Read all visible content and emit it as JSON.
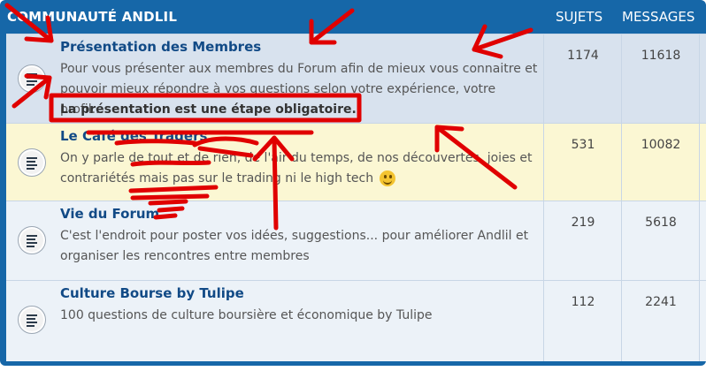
{
  "header": {
    "title": "COMMUNAUTÉ ANDLIL",
    "col_topics": "SUJETS",
    "col_posts": "MESSAGES"
  },
  "forums": [
    {
      "title": "Présentation des Membres",
      "description": "Pour vous présenter aux membres du Forum afin de mieux vous connaitre et pouvoir mieux répondre à vos questions selon votre expérience, votre profil...",
      "note": "La présentation est une étape obligatoire.",
      "topics": "1174",
      "posts": "11618",
      "icon": "forum-read-icon"
    },
    {
      "title": "Le Café des Traders",
      "description": "On y parle de tout et de rien, de l'air du temps, de nos découvertes, joies et contrariétés mais pas sur le trading ni le high tech",
      "topics": "531",
      "posts": "10082",
      "icon": "forum-read-icon",
      "emoji": "wink-smiley-icon"
    },
    {
      "title": "Vie du Forum",
      "description": "C'est l'endroit pour poster vos idées, suggestions... pour améliorer Andlil et organiser les rencontres entre membres",
      "topics": "219",
      "posts": "5618",
      "icon": "forum-read-icon"
    },
    {
      "title": "Culture Bourse by Tulipe",
      "description": "100 questions de culture boursière et économique by Tulipe",
      "topics": "112",
      "posts": "2241",
      "icon": "forum-read-icon"
    }
  ],
  "colors": {
    "header_bg": "#1667a8",
    "row_default": "#ecf2f8",
    "row_hover": "#d8e2ee",
    "row_highlight": "#fbf7d3",
    "title_link": "#114a86",
    "annotation_red": "#e00000"
  }
}
